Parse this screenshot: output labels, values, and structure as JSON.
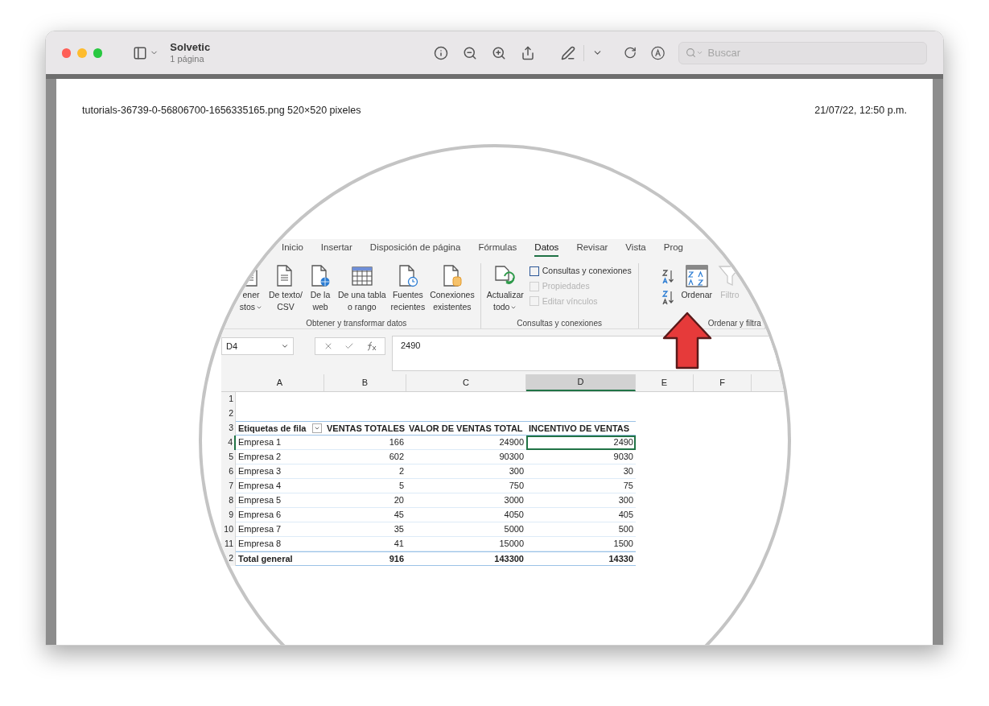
{
  "window": {
    "title": "Solvetic",
    "subtitle": "1 página"
  },
  "toolbar": {
    "search": {
      "placeholder": "Buscar"
    }
  },
  "page": {
    "file_info": "tutorials-36739-0-56806700-1656335165.png 520×520 pixeles",
    "timestamp": "21/07/22, 12:50 p.m."
  },
  "excel": {
    "tabs": [
      {
        "label": "Inicio",
        "selected": false
      },
      {
        "label": "Insertar",
        "selected": false
      },
      {
        "label": "Disposición de página",
        "selected": false
      },
      {
        "label": "Fórmulas",
        "selected": false
      },
      {
        "label": "Datos",
        "selected": true
      },
      {
        "label": "Revisar",
        "selected": false
      },
      {
        "label": "Vista",
        "selected": false
      },
      {
        "label": "Prog",
        "selected": false
      }
    ],
    "ribbon_groups": [
      {
        "label": "Obtener y transformar datos",
        "items": [
          {
            "kind": "document",
            "lines": [
              "ener",
              "stos"
            ],
            "dropdown": true,
            "disabled": false
          },
          {
            "kind": "document",
            "lines": [
              "De texto/",
              "CSV"
            ],
            "dropdown": false,
            "disabled": false
          },
          {
            "kind": "web",
            "lines": [
              "De la",
              "web"
            ],
            "dropdown": false,
            "disabled": false
          },
          {
            "kind": "table",
            "lines": [
              "De una tabla",
              "o rango"
            ],
            "dropdown": false,
            "disabled": false
          },
          {
            "kind": "recent",
            "lines": [
              "Fuentes",
              "recientes"
            ],
            "dropdown": false,
            "disabled": false
          },
          {
            "kind": "database",
            "lines": [
              "Conexiones",
              "existentes"
            ],
            "dropdown": false,
            "disabled": false
          }
        ]
      },
      {
        "label": "Consultas y conexiones",
        "items": [
          {
            "kind": "refresh",
            "lines": [
              "Actualizar",
              "todo"
            ],
            "dropdown": true,
            "disabled": false
          },
          {
            "kind": "list",
            "entries": [
              {
                "label": "Consultas y conexiones",
                "disabled": false
              },
              {
                "label": "Propiedades",
                "disabled": true
              },
              {
                "label": "Editar vínculos",
                "disabled": true
              }
            ]
          }
        ]
      },
      {
        "label": "Ordenar y filtra",
        "items": [
          {
            "kind": "sortpair"
          },
          {
            "kind": "sortbox",
            "lines": [
              "Ordenar"
            ],
            "dropdown": false,
            "disabled": false
          },
          {
            "kind": "filter",
            "lines": [
              "Filtro"
            ],
            "dropdown": false,
            "disabled": true
          }
        ]
      }
    ],
    "name_box": "D4",
    "formula": "2490",
    "columns": [
      {
        "label": "A",
        "selected": false
      },
      {
        "label": "B",
        "selected": false
      },
      {
        "label": "C",
        "selected": false
      },
      {
        "label": "D",
        "selected": true
      },
      {
        "label": "E",
        "selected": false
      },
      {
        "label": "F",
        "selected": false
      }
    ],
    "rows": [
      {
        "number": "1",
        "selected": false,
        "cells": []
      },
      {
        "number": "2",
        "selected": false,
        "cells": []
      },
      {
        "number": "3",
        "kind": "header",
        "selected": false,
        "filter_button": true,
        "cells": [
          "Etiquetas de fila",
          "VENTAS TOTALES",
          "VALOR DE VENTAS TOTAL",
          "INCENTIVO DE VENTAS"
        ]
      },
      {
        "number": "4",
        "kind": "data",
        "selected": true,
        "cells": [
          "Empresa 1",
          "166",
          "24900",
          "2490"
        ]
      },
      {
        "number": "5",
        "kind": "data",
        "selected": false,
        "cells": [
          "Empresa 2",
          "602",
          "90300",
          "9030"
        ]
      },
      {
        "number": "6",
        "kind": "data",
        "selected": false,
        "cells": [
          "Empresa 3",
          "2",
          "300",
          "30"
        ]
      },
      {
        "number": "7",
        "kind": "data",
        "selected": false,
        "cells": [
          "Empresa 4",
          "5",
          "750",
          "75"
        ]
      },
      {
        "number": "8",
        "kind": "data",
        "selected": false,
        "cells": [
          "Empresa 5",
          "20",
          "3000",
          "300"
        ]
      },
      {
        "number": "9",
        "kind": "data",
        "selected": false,
        "cells": [
          "Empresa 6",
          "45",
          "4050",
          "405"
        ]
      },
      {
        "number": "10",
        "kind": "data",
        "selected": false,
        "cells": [
          "Empresa 7",
          "35",
          "5000",
          "500"
        ]
      },
      {
        "number": "11",
        "kind": "data",
        "selected": false,
        "cells": [
          "Empresa 8",
          "41",
          "15000",
          "1500"
        ]
      },
      {
        "number": "2",
        "kind": "total",
        "selected": false,
        "cells": [
          "Total general",
          "916",
          "143300",
          "14330"
        ]
      }
    ]
  }
}
